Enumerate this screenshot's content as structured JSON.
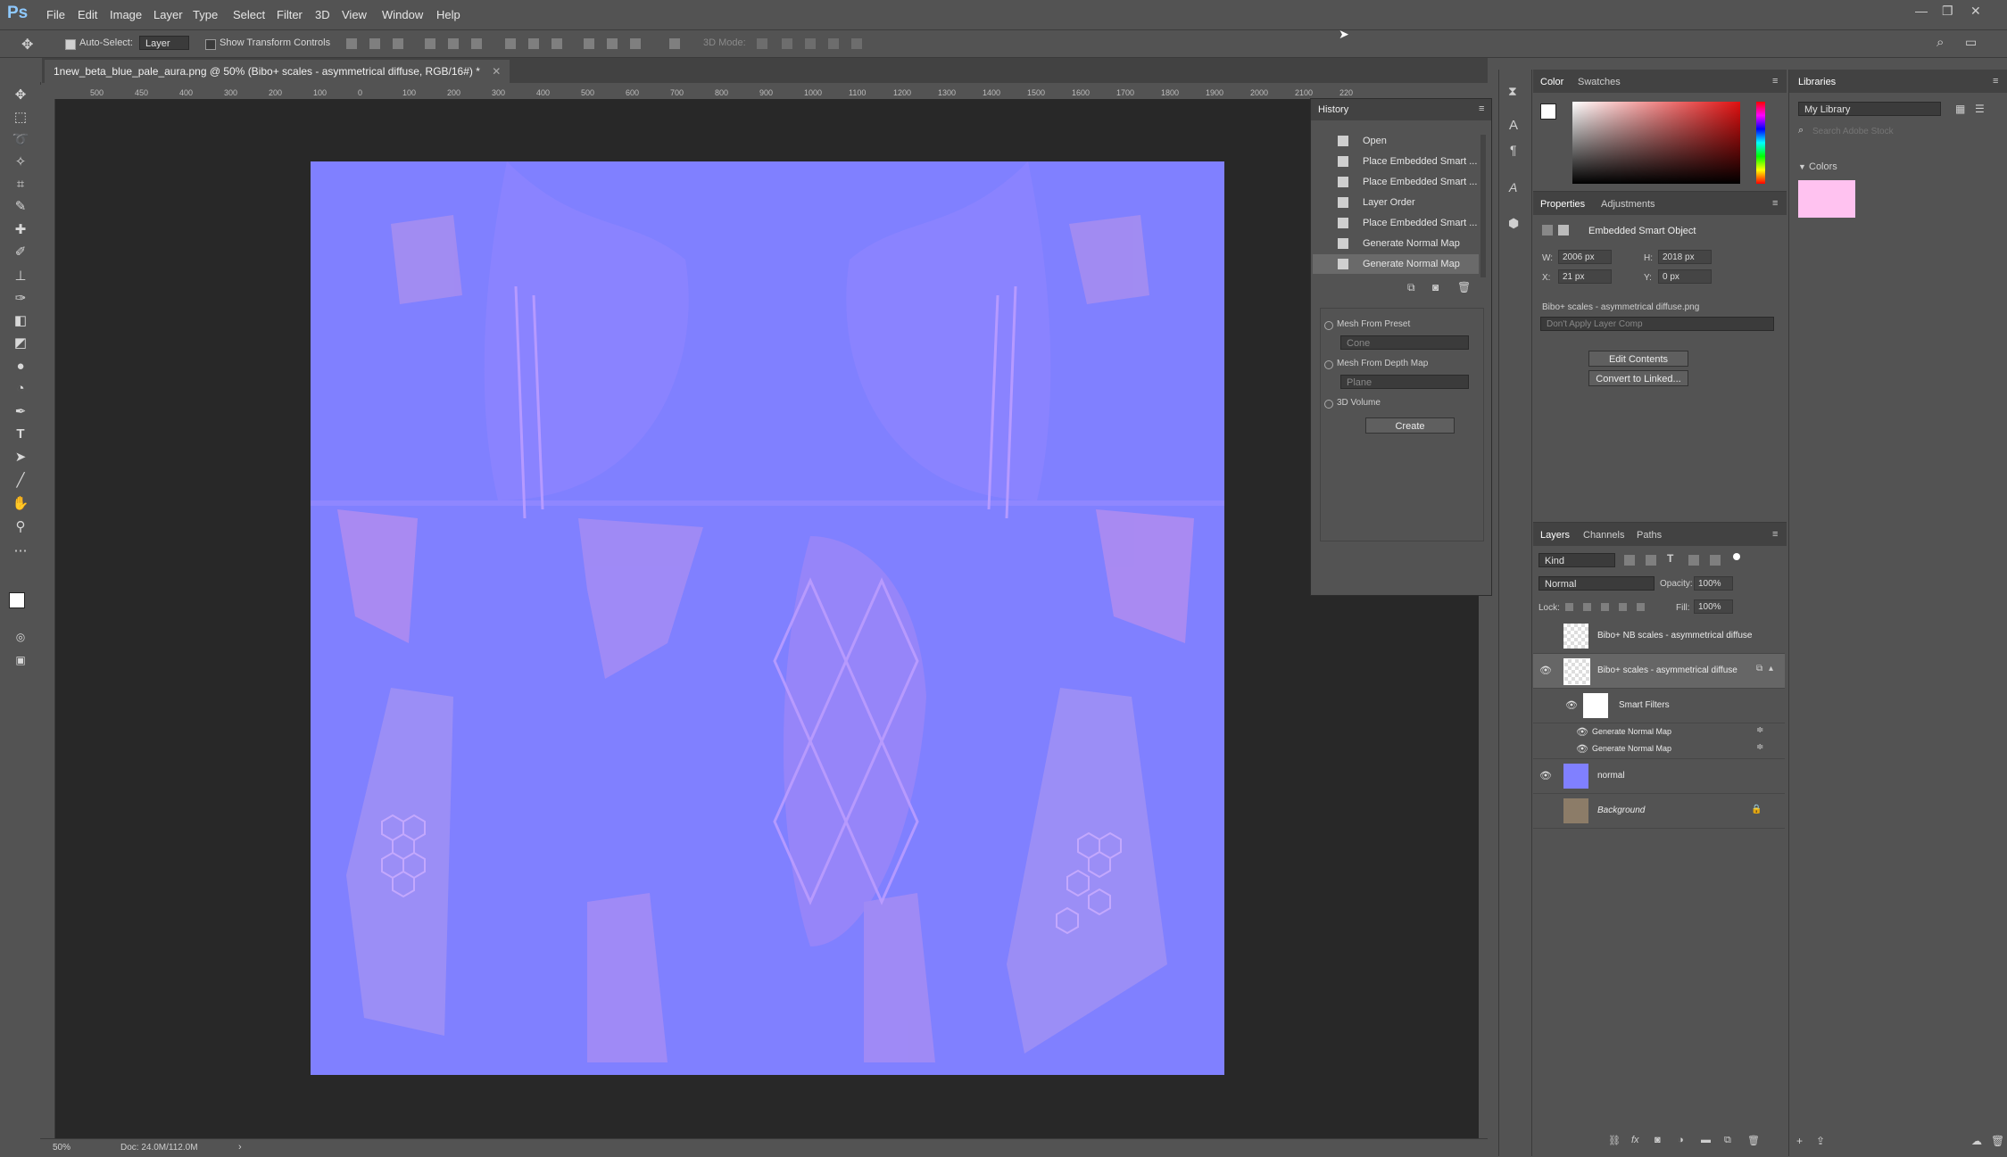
{
  "app": {
    "logo": "Ps"
  },
  "menu": [
    "File",
    "Edit",
    "Image",
    "Layer",
    "Type",
    "Select",
    "Filter",
    "3D",
    "View",
    "Window",
    "Help"
  ],
  "window_controls": {
    "minimize": "—",
    "maximize": "❐",
    "close": "✕"
  },
  "options": {
    "auto_select_label": "Auto-Select:",
    "auto_select_value": "Layer",
    "show_transform_label": "Show Transform Controls",
    "mode_label": "3D Mode:"
  },
  "document": {
    "tab_title": "1new_beta_blue_pale_aura.png @ 50% (Bibo+ scales - asymmetrical diffuse, RGB/16#) *",
    "close": "✕"
  },
  "ruler_top": [
    "500",
    "450",
    "400",
    "300",
    "200",
    "100",
    "0",
    "100",
    "200",
    "300",
    "400",
    "500",
    "600",
    "700",
    "800",
    "900",
    "1000",
    "1100",
    "1200",
    "1300",
    "1400",
    "1500",
    "1600",
    "1700",
    "1800",
    "1900",
    "2000",
    "2100",
    "220"
  ],
  "status": {
    "zoom": "50%",
    "doc": "Doc: 24.0M/112.0M"
  },
  "history": {
    "title": "History",
    "items": [
      "Open",
      "Place Embedded Smart ...",
      "Place Embedded Smart ...",
      "Layer Order",
      "Place Embedded Smart ...",
      "Generate Normal Map",
      "Generate Normal Map"
    ],
    "below": {
      "mesh_preset": "Mesh From Preset",
      "mesh_preset_value": "Cone",
      "mesh_depth": "Mesh From Depth Map",
      "mesh_depth_value": "Plane",
      "volume": "3D Volume",
      "create": "Create"
    }
  },
  "color_panel": {
    "tab_color": "Color",
    "tab_swatches": "Swatches"
  },
  "properties": {
    "tab": "Properties",
    "tab2": "Adjustments",
    "type": "Embedded Smart Object",
    "w_label": "W:",
    "w_value": "2006 px",
    "h_label": "H:",
    "h_value": "2018 px",
    "x_label": "X:",
    "x_value": "21 px",
    "y_label": "Y:",
    "y_value": "0 px",
    "source": "Bibo+ scales - asymmetrical diffuse.png",
    "comp": "Don't Apply Layer Comp",
    "edit": "Edit Contents",
    "convert": "Convert to Linked..."
  },
  "layers": {
    "tab_layers": "Layers",
    "tab_channels": "Channels",
    "tab_paths": "Paths",
    "filter": "Kind",
    "blend": "Normal",
    "opacity_label": "Opacity:",
    "opacity": "100%",
    "lock_label": "Lock:",
    "fill_label": "Fill:",
    "fill": "100%",
    "rows": [
      {
        "name": "Bibo+ NB scales - asymmetrical diffuse",
        "visible": false
      },
      {
        "name": "Bibo+ scales - asymmetrical diffuse",
        "visible": true
      },
      {
        "name": "Smart Filters",
        "visible": true
      },
      {
        "name": "Generate Normal Map",
        "visible": true
      },
      {
        "name": "Generate Normal Map",
        "visible": true
      },
      {
        "name": "normal",
        "visible": true
      },
      {
        "name": "Background",
        "visible": false
      }
    ]
  },
  "libraries": {
    "tab": "Libraries",
    "library": "My Library",
    "search_placeholder": "Search Adobe Stock",
    "colors_label": "Colors",
    "swatch": "#ffc2f0"
  },
  "colors": {
    "accent": "#8080ff",
    "panel": "#535353"
  }
}
